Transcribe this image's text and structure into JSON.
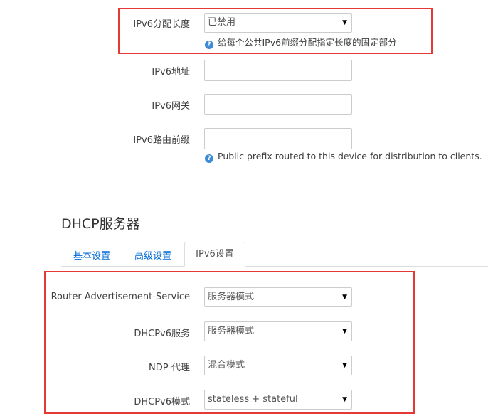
{
  "ipv6_assign": {
    "label": "IPv6分配长度",
    "value": "已禁用",
    "hint": "给每个公共IPv6前缀分配指定长度的固定部分"
  },
  "ipv6_address": {
    "label": "IPv6地址",
    "value": ""
  },
  "ipv6_gateway": {
    "label": "IPv6网关",
    "value": ""
  },
  "ipv6_prefix": {
    "label": "IPv6路由前缀",
    "value": "",
    "hint": "Public prefix routed to this device for distribution to clients."
  },
  "dhcp": {
    "title": "DHCP服务器",
    "tabs": [
      {
        "label": "基本设置",
        "active": false
      },
      {
        "label": "高级设置",
        "active": false
      },
      {
        "label": "IPv6设置",
        "active": true
      }
    ],
    "fields": [
      {
        "label": "Router Advertisement-Service",
        "value": "服务器模式"
      },
      {
        "label": "DHCPv6服务",
        "value": "服务器模式"
      },
      {
        "label": "NDP-代理",
        "value": "混合模式"
      },
      {
        "label": "DHCPv6模式",
        "value": "stateless + stateful"
      }
    ]
  },
  "icons": {
    "help": "help-circle-icon",
    "dropdown": "dropdown-arrow-icon"
  },
  "colors": {
    "highlight_box": "#e53935",
    "tab_link": "#0069d6",
    "help_icon": "#3b8bd6"
  }
}
